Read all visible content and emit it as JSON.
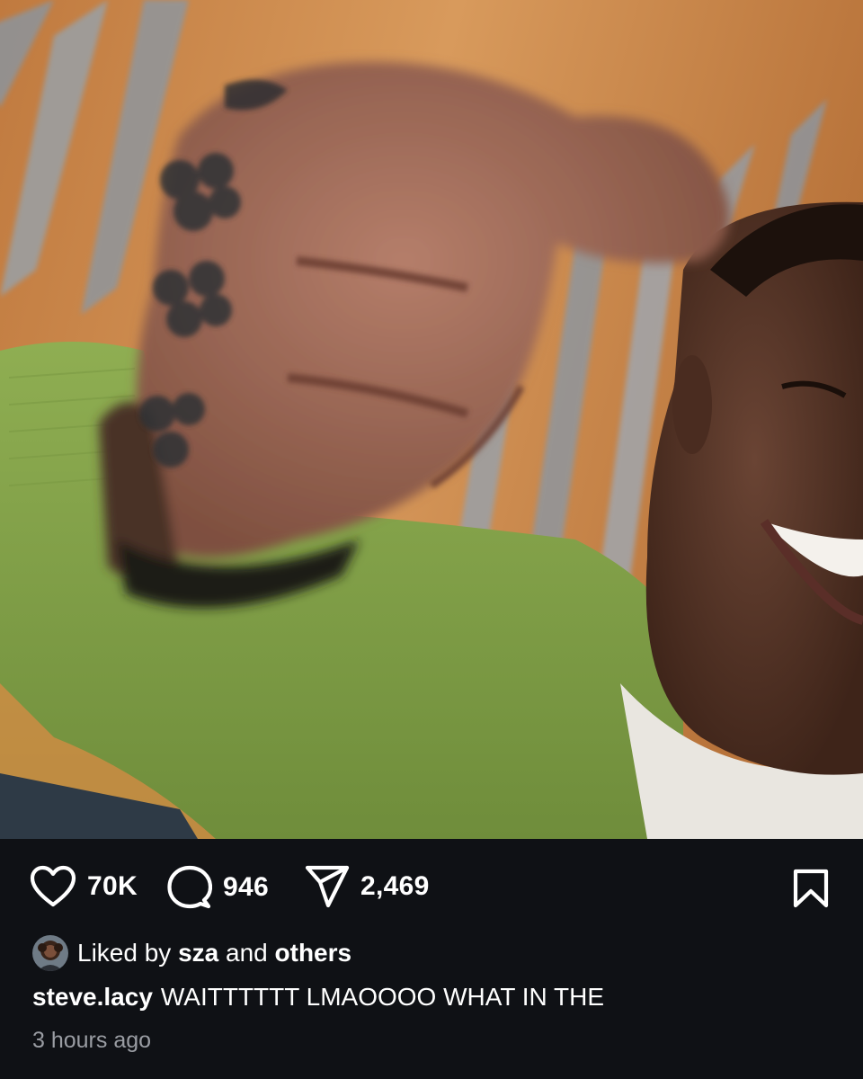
{
  "post": {
    "image_alt": "Selfie of a smiling man in a green sweater holding a blurred tattooed hand up to the camera",
    "actions": {
      "likes": "70K",
      "comments": "946",
      "shares": "2,469"
    },
    "liked_by": {
      "prefix": "Liked by",
      "user": "sza",
      "middle": "and",
      "suffix": "others"
    },
    "caption": {
      "username": "steve.lacy",
      "text": "WAITTTTTT LMAOOOO WHAT IN THE"
    },
    "timestamp": "3 hours ago"
  },
  "icons": {
    "like": "heart-icon",
    "comment": "comment-bubble-icon",
    "share": "paper-plane-icon",
    "save": "bookmark-icon"
  },
  "colors": {
    "background": "#0f1115",
    "text": "#ffffff",
    "secondary_text": "#9a9da3"
  }
}
